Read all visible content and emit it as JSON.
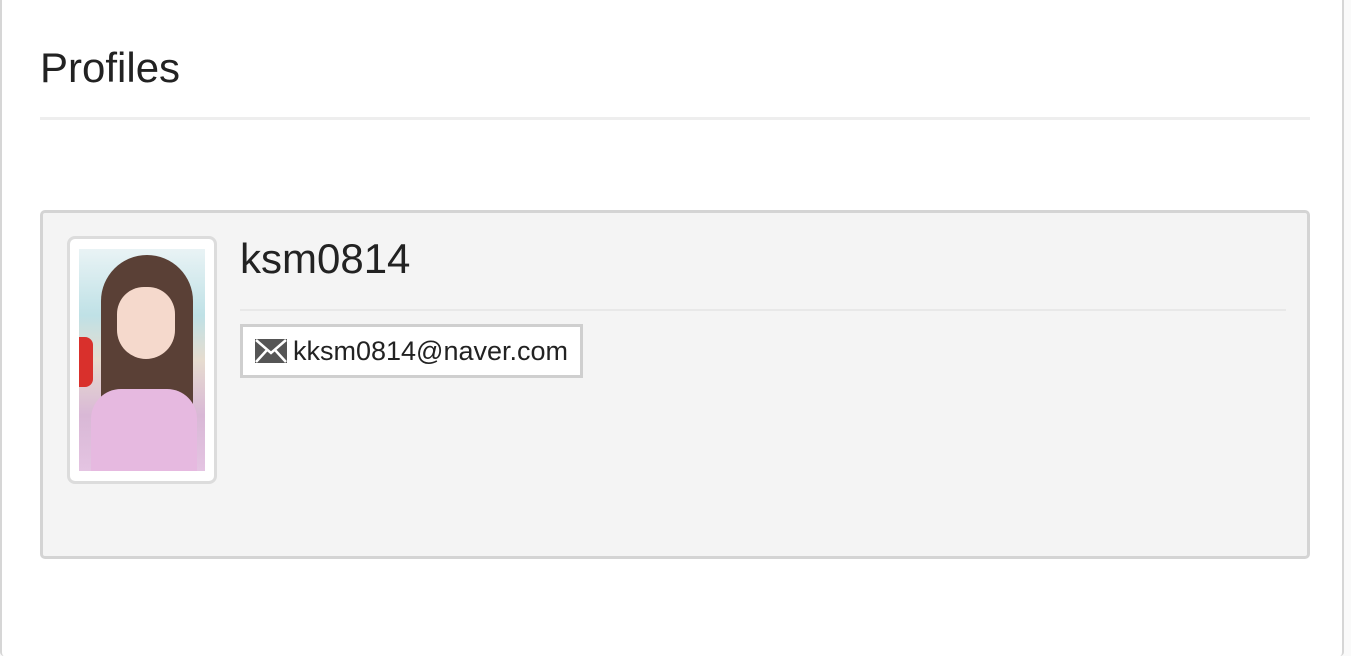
{
  "page": {
    "title": "Profiles"
  },
  "profile": {
    "username": "ksm0814",
    "email": "kksm0814@naver.com",
    "email_icon": "envelope-icon",
    "photo_alt": "profile photo"
  },
  "colors": {
    "card_bg": "#f4f4f4",
    "card_border": "#d4d4d4",
    "icon": "#555555"
  }
}
